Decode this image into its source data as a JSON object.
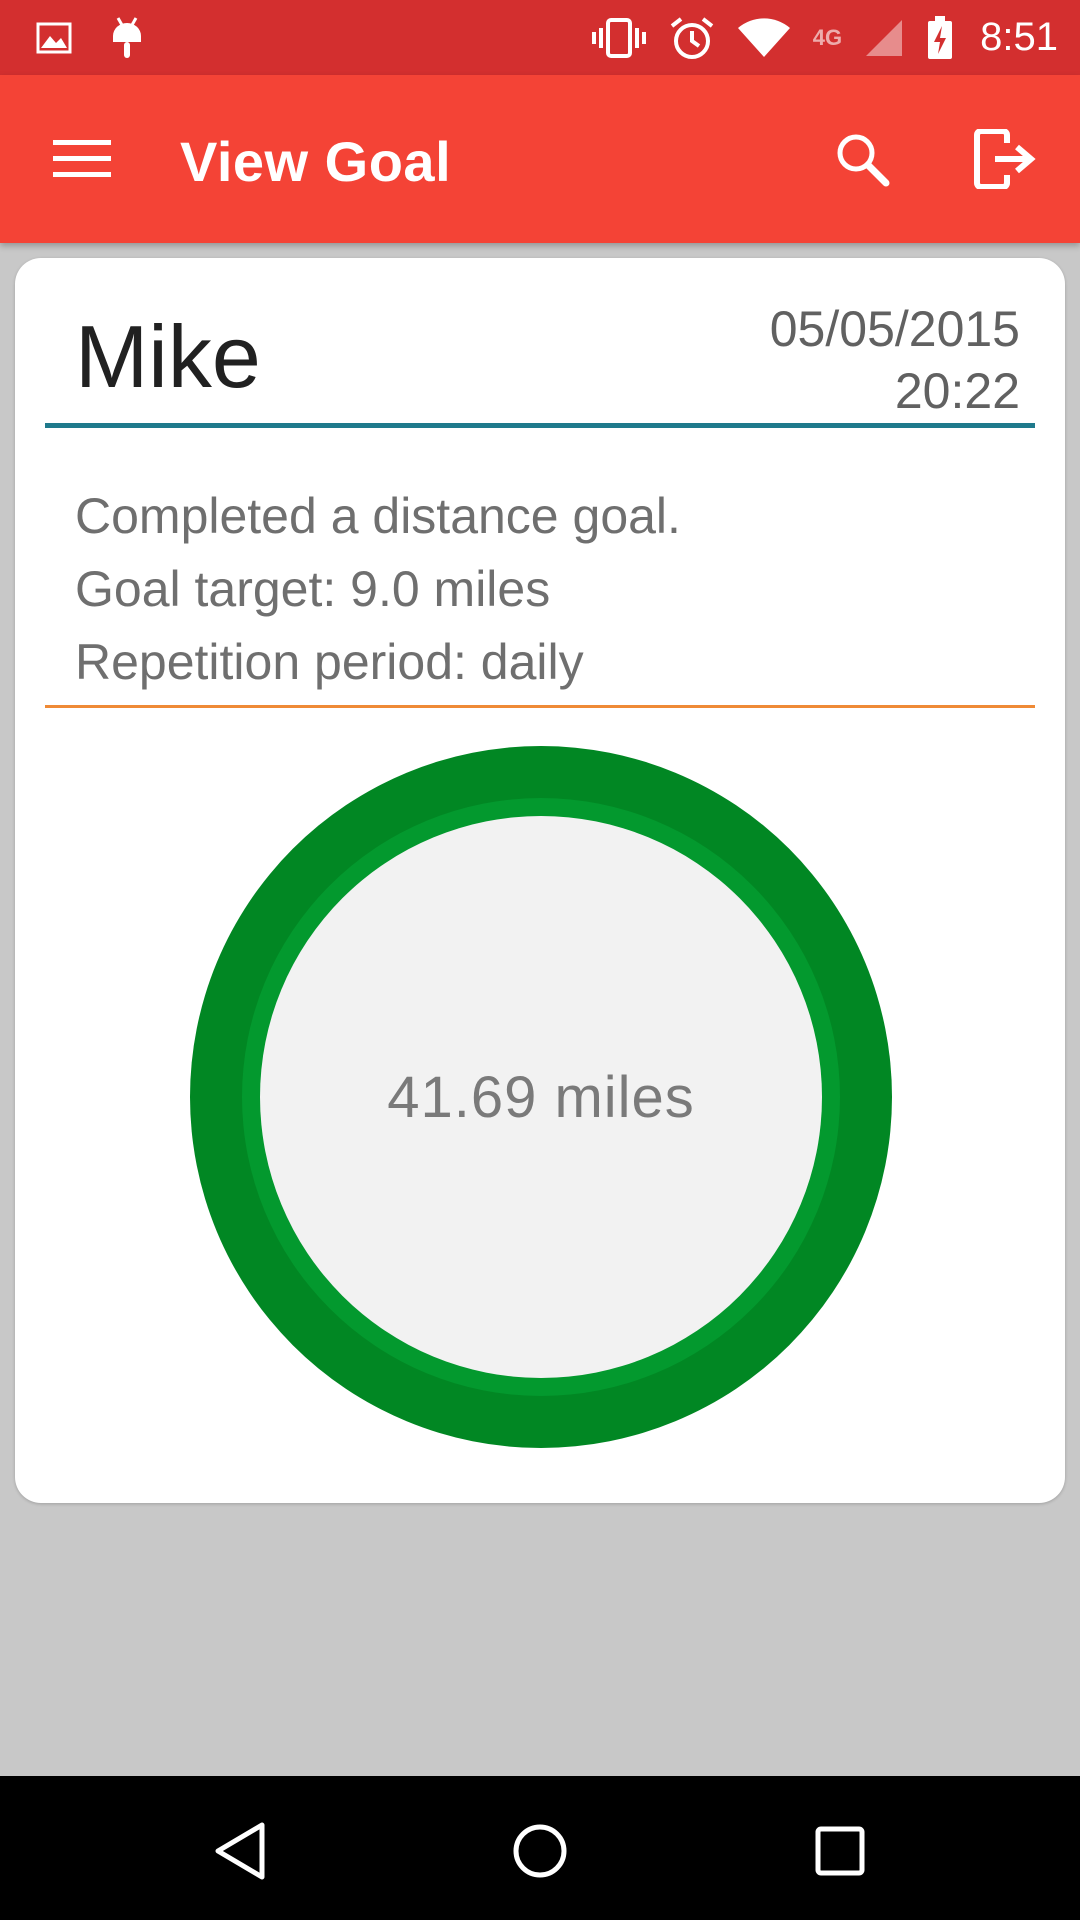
{
  "status_bar": {
    "time": "8:51",
    "left_icons": [
      "image-icon",
      "android-debug-icon"
    ],
    "right_icons": [
      "vibrate-icon",
      "alarm-icon",
      "wifi-icon",
      "lte-icon",
      "signal-icon",
      "battery-charging-icon"
    ],
    "network_label": "4G"
  },
  "app_bar": {
    "title": "View Goal",
    "icons": [
      "menu-icon",
      "search-icon",
      "logout-icon"
    ]
  },
  "goal": {
    "user": "Mike",
    "date": "05/05/2015",
    "time": "20:22",
    "details": [
      "Completed a distance goal.",
      "Goal target: 9.0 miles",
      "Repetition period: daily"
    ],
    "distance": "41.69 miles",
    "progress_fraction": 1.0
  },
  "colors": {
    "status_bar": "#d32f2f",
    "app_bar": "#f44336",
    "ring_outer": "#018723",
    "ring_inner": "#03992e",
    "divider_teal": "#1f7a8c",
    "divider_orange": "#ef8a36"
  },
  "nav_bar": {
    "icons": [
      "back-icon",
      "home-icon",
      "recents-icon"
    ]
  }
}
